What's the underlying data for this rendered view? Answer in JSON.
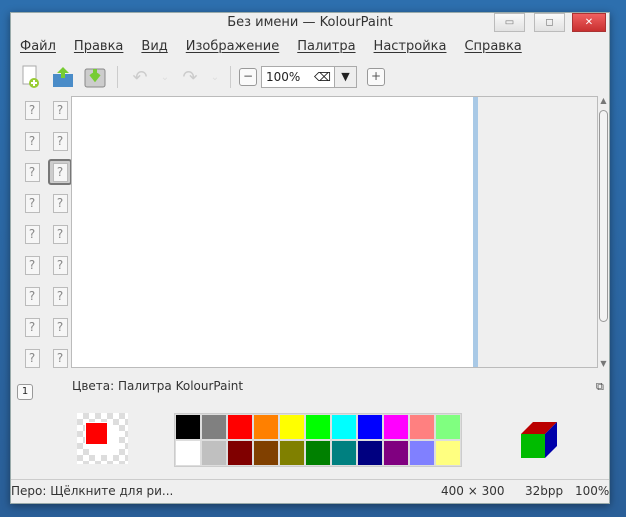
{
  "window": {
    "title": "Без имени — KolourPaint"
  },
  "menu": [
    "Файл",
    "Правка",
    "Вид",
    "Изображение",
    "Палитра",
    "Настройка",
    "Справка"
  ],
  "toolbar": {
    "zoom_value": "100%",
    "clear_icon": "⌫",
    "dropdown": "▼",
    "zoom_out": "−",
    "zoom_in": "+"
  },
  "tools": {
    "count": 18,
    "selected_index": 5,
    "glyph": "?"
  },
  "palette_panel": {
    "label": "Цвета: Палитра KolourPaint",
    "button": "1",
    "float": "⧉"
  },
  "colors": {
    "foreground": "#ff0000",
    "background": "#ffffff",
    "row1": [
      "#000000",
      "#808080",
      "#ff0000",
      "#ff8000",
      "#ffff00",
      "#00ff00",
      "#00ffff",
      "#0000ff",
      "#ff00ff",
      "#ff8080",
      "#80ff80"
    ],
    "row2": [
      "#ffffff",
      "#c0c0c0",
      "#800000",
      "#804000",
      "#808000",
      "#008000",
      "#008080",
      "#000080",
      "#800080",
      "#8080ff",
      "#ffff80"
    ]
  },
  "status": {
    "message": "Перо: Щёлкните для ри...",
    "size": "400 × 300",
    "depth": "32bpp",
    "zoom": "100%"
  }
}
